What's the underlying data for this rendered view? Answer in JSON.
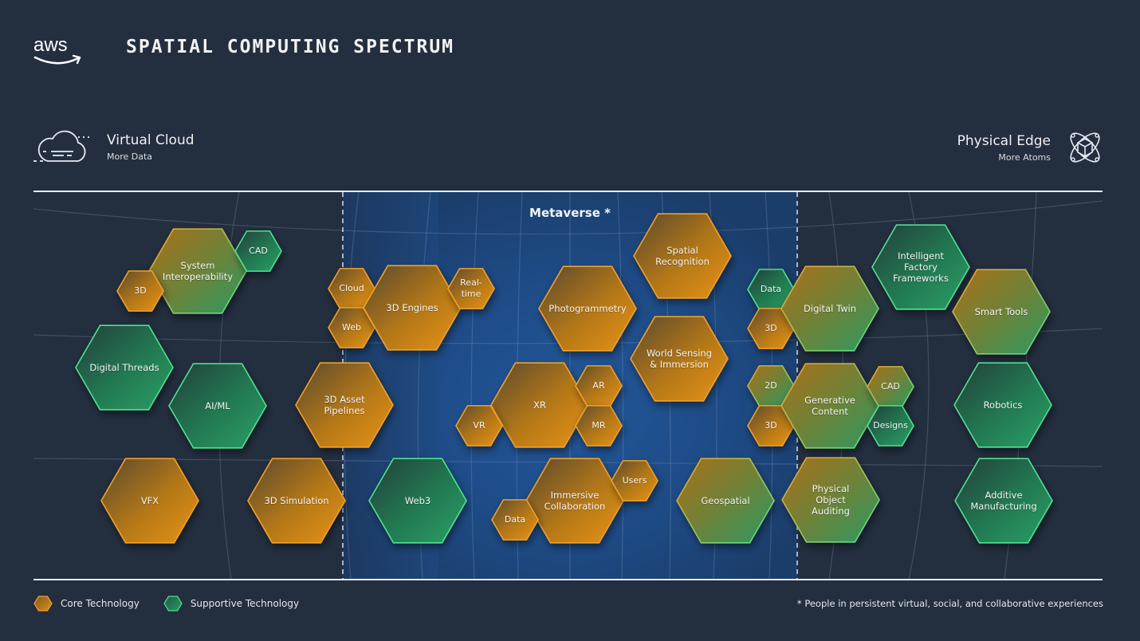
{
  "header": {
    "logo_text": "aws",
    "title": "SPATIAL COMPUTING SPECTRUM"
  },
  "spectrum": {
    "left": {
      "title": "Virtual Cloud",
      "subtitle": "More Data",
      "icon": "cloud-icon"
    },
    "right": {
      "title": "Physical Edge",
      "subtitle": "More Atoms",
      "icon": "atom-cube-icon"
    },
    "center_label": "Metaverse *"
  },
  "colors": {
    "background": "#232e3f",
    "metaverse_band": "#1f4a82",
    "core_fill_dark": "#5a4a2a",
    "core_fill_light": "#e0901a",
    "core_stroke": "#f0a02a",
    "support_fill_dark": "#1f4a3d",
    "support_fill_light": "#2a9a62",
    "support_stroke": "#4fe08f"
  },
  "hexagons": [
    {
      "id": "system-interoperability",
      "label": "System\nInteroperability",
      "type": "mixed",
      "size": "large"
    },
    {
      "id": "cad-top-left",
      "label": "CAD",
      "type": "support",
      "size": "small"
    },
    {
      "id": "3d-top-left",
      "label": "3D",
      "type": "core",
      "size": "small"
    },
    {
      "id": "digital-threads",
      "label": "Digital Threads",
      "type": "support",
      "size": "large"
    },
    {
      "id": "ai-ml",
      "label": "AI/ML",
      "type": "support",
      "size": "large"
    },
    {
      "id": "vfx",
      "label": "VFX",
      "type": "core",
      "size": "large"
    },
    {
      "id": "3d-simulation",
      "label": "3D Simulation",
      "type": "core",
      "size": "large"
    },
    {
      "id": "cloud",
      "label": "Cloud",
      "type": "core",
      "size": "small"
    },
    {
      "id": "web",
      "label": "Web",
      "type": "core",
      "size": "small"
    },
    {
      "id": "3d-engines",
      "label": "3D Engines",
      "type": "core",
      "size": "large"
    },
    {
      "id": "real-time",
      "label": "Real-\ntime",
      "type": "core",
      "size": "small"
    },
    {
      "id": "3d-asset-pipelines",
      "label": "3D Asset\nPipelines",
      "type": "core",
      "size": "large"
    },
    {
      "id": "web3",
      "label": "Web3",
      "type": "support",
      "size": "large"
    },
    {
      "id": "photogrammetry",
      "label": "Photogrammetry",
      "type": "core",
      "size": "large"
    },
    {
      "id": "spatial-recognition",
      "label": "Spatial\nRecognition",
      "type": "core",
      "size": "large"
    },
    {
      "id": "world-sensing",
      "label": "World Sensing\n& Immersion",
      "type": "core",
      "size": "large"
    },
    {
      "id": "xr",
      "label": "XR",
      "type": "core",
      "size": "large"
    },
    {
      "id": "ar",
      "label": "AR",
      "type": "core",
      "size": "small"
    },
    {
      "id": "mr",
      "label": "MR",
      "type": "core",
      "size": "small"
    },
    {
      "id": "vr",
      "label": "VR",
      "type": "core",
      "size": "small"
    },
    {
      "id": "immersive-collaboration",
      "label": "Immersive\nCollaboration",
      "type": "core",
      "size": "large"
    },
    {
      "id": "users",
      "label": "Users",
      "type": "core",
      "size": "small"
    },
    {
      "id": "data-bottom",
      "label": "Data",
      "type": "core",
      "size": "small"
    },
    {
      "id": "geospatial",
      "label": "Geospatial",
      "type": "mixed",
      "size": "large"
    },
    {
      "id": "data-right",
      "label": "Data",
      "type": "support",
      "size": "small"
    },
    {
      "id": "3d-right-top",
      "label": "3D",
      "type": "core",
      "size": "small"
    },
    {
      "id": "digital-twin",
      "label": "Digital Twin",
      "type": "mixed",
      "size": "large"
    },
    {
      "id": "2d",
      "label": "2D",
      "type": "mixed",
      "size": "small"
    },
    {
      "id": "3d-right-bottom",
      "label": "3D",
      "type": "core",
      "size": "small"
    },
    {
      "id": "generative-content",
      "label": "Generative\nContent",
      "type": "mixed",
      "size": "large"
    },
    {
      "id": "cad-right",
      "label": "CAD",
      "type": "mixed",
      "size": "small"
    },
    {
      "id": "designs",
      "label": "Designs",
      "type": "support",
      "size": "small"
    },
    {
      "id": "physical-object-auditing",
      "label": "Physical\nObject\nAuditing",
      "type": "mixed",
      "size": "large"
    },
    {
      "id": "intelligent-factory-frameworks",
      "label": "Intelligent\nFactory\nFrameworks",
      "type": "support",
      "size": "large"
    },
    {
      "id": "smart-tools",
      "label": "Smart Tools",
      "type": "mixed",
      "size": "large"
    },
    {
      "id": "robotics",
      "label": "Robotics",
      "type": "support",
      "size": "large"
    },
    {
      "id": "additive-manufacturing",
      "label": "Additive\nManufacturing",
      "type": "support",
      "size": "large"
    }
  ],
  "legend": {
    "core": "Core Technology",
    "support": "Supportive Technology"
  },
  "footnote": "* People in persistent virtual, social, and collaborative experiences"
}
